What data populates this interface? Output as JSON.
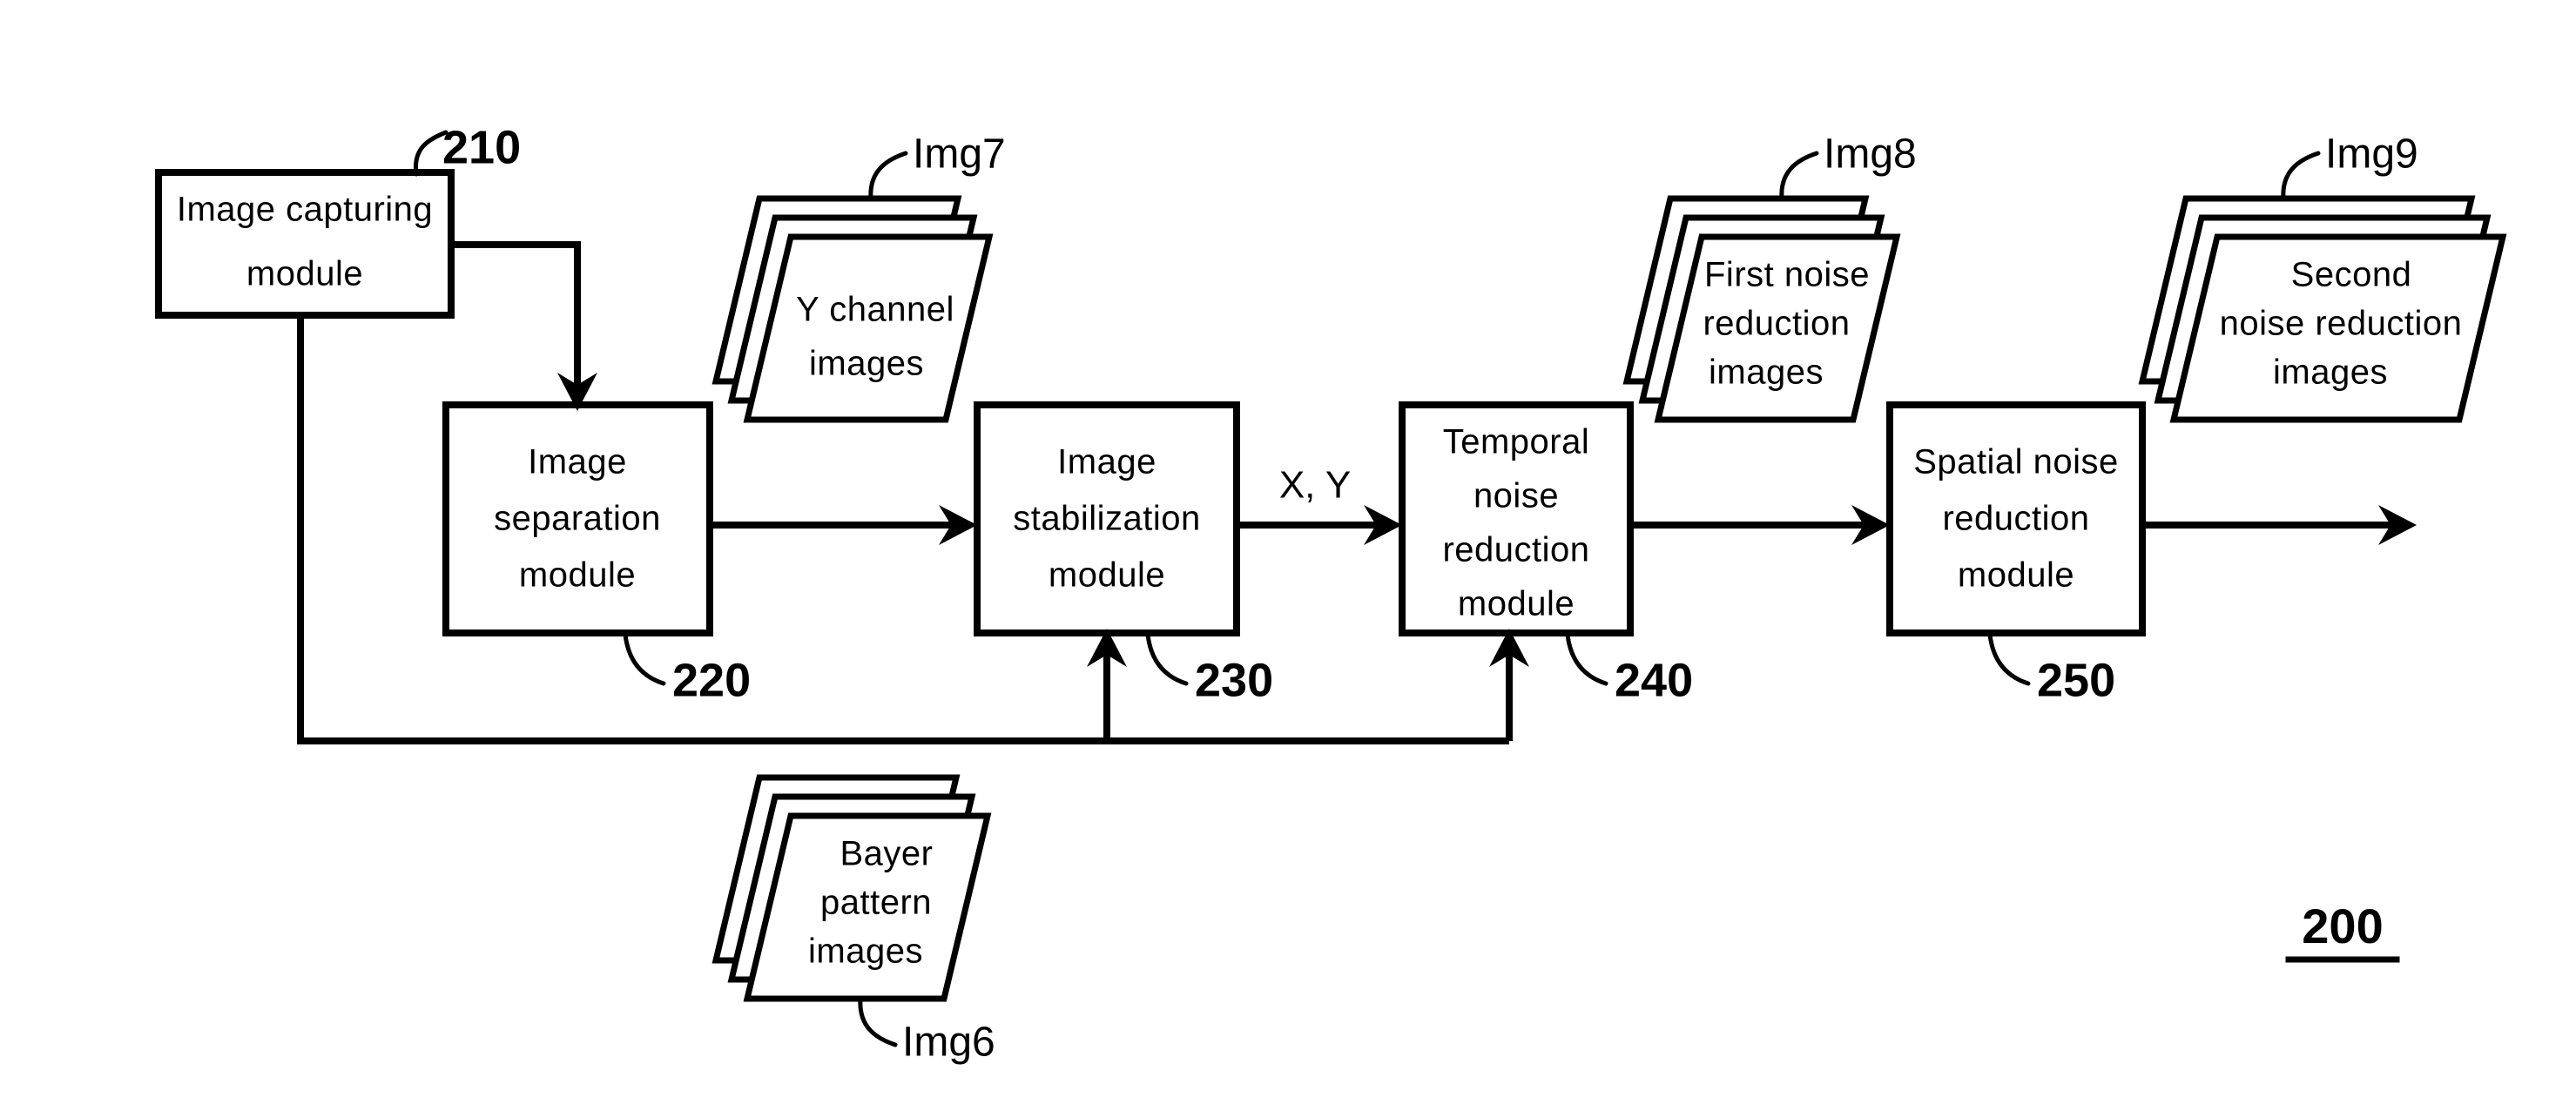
{
  "figure": {
    "number": "200",
    "underlined": true
  },
  "modules": [
    {
      "id": "image-capturing",
      "lines": [
        "Image capturing",
        "module"
      ],
      "ref": "210"
    },
    {
      "id": "image-separation",
      "lines": [
        "Image",
        "separation",
        "module"
      ],
      "ref": "220"
    },
    {
      "id": "image-stabilization",
      "lines": [
        "Image",
        "stabilization",
        "module"
      ],
      "ref": "230"
    },
    {
      "id": "temporal-noise-reduction",
      "lines": [
        "Temporal",
        "noise",
        "reduction",
        "module"
      ],
      "ref": "240"
    },
    {
      "id": "spatial-noise-reduction",
      "lines": [
        "Spatial noise",
        "reduction",
        "module"
      ],
      "ref": "250"
    }
  ],
  "image_stacks": [
    {
      "id": "y-channel-images",
      "lines": [
        "Y channel",
        "images"
      ],
      "tag": "Img7"
    },
    {
      "id": "first-noise-reduction-images",
      "lines": [
        "First noise",
        "reduction",
        "images"
      ],
      "tag": "Img8"
    },
    {
      "id": "second-noise-reduction-images",
      "lines": [
        "Second",
        "noise reduction",
        "images"
      ],
      "tag": "Img9"
    },
    {
      "id": "bayer-pattern-images",
      "lines": [
        "Bayer",
        "pattern",
        "images"
      ],
      "tag": "Img6"
    }
  ],
  "signals": [
    {
      "id": "xy-signal",
      "label": "X, Y"
    }
  ],
  "colors": {
    "ink": "#000000",
    "paper": "#ffffff"
  }
}
